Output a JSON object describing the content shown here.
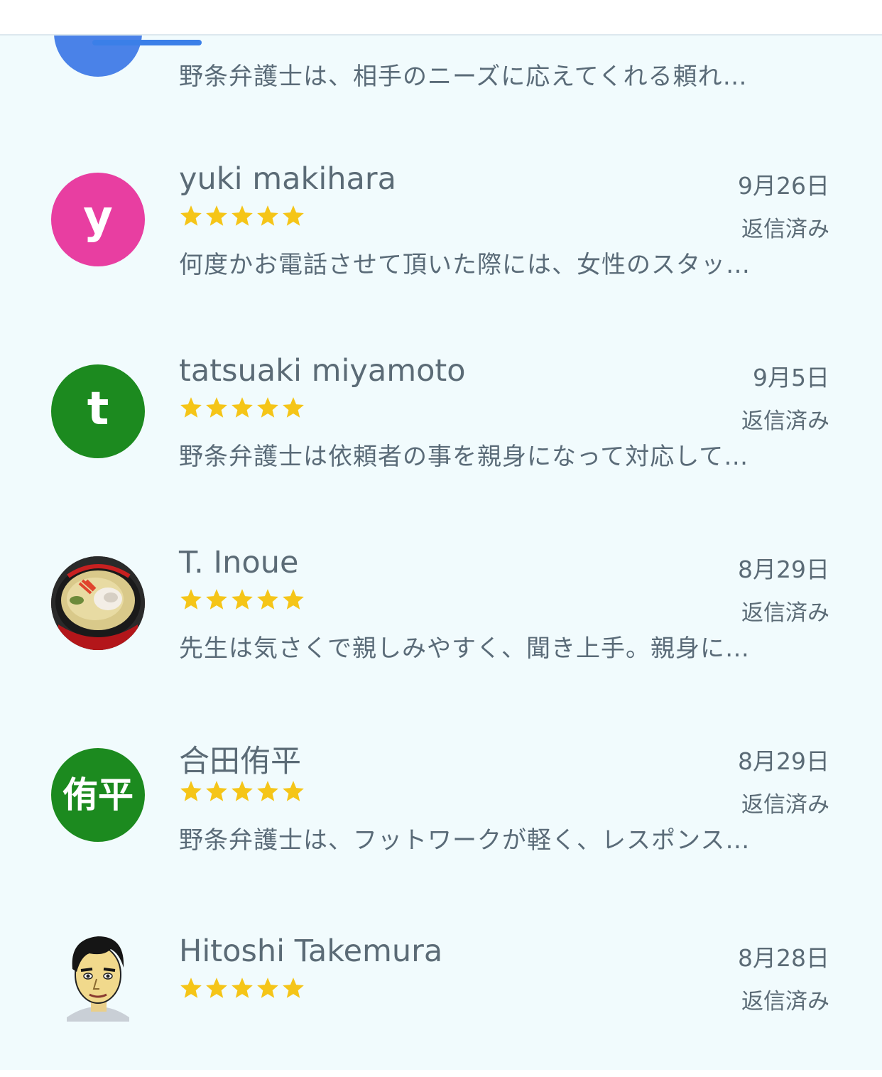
{
  "partial_review": {
    "snippet": "野条弁護士は、相手のニーズに応えてくれる頼れ…"
  },
  "reviews": [
    {
      "name": "yuki makihara",
      "date": "9月26日",
      "rating": 5,
      "status": "返信済み",
      "snippet": "何度かお電話させて頂いた際には、女性のスタッ…",
      "avatar": {
        "type": "letter",
        "text": "y",
        "color": "#e83ea1"
      }
    },
    {
      "name": "tatsuaki miyamoto",
      "date": "9月5日",
      "rating": 5,
      "status": "返信済み",
      "snippet": "野条弁護士は依頼者の事を親身になって対応して…",
      "avatar": {
        "type": "letter",
        "text": "t",
        "color": "#1c8a1f"
      }
    },
    {
      "name": "T. Inoue",
      "date": "8月29日",
      "rating": 5,
      "status": "返信済み",
      "snippet": "先生は気さくで親しみやすく、聞き上手。親身に…",
      "avatar": {
        "type": "photo",
        "icon": "ramen-photo"
      }
    },
    {
      "name": "合田侑平",
      "date": "8月29日",
      "rating": 5,
      "status": "返信済み",
      "snippet": "野条弁護士は、フットワークが軽く、レスポンス…",
      "avatar": {
        "type": "kanji",
        "text": "侑平",
        "color": "#1c8a1f"
      }
    },
    {
      "name": "Hitoshi Takemura",
      "date": "8月28日",
      "rating": 5,
      "status": "返信済み",
      "avatar": {
        "type": "photo",
        "icon": "caricature-portrait"
      }
    }
  ],
  "colors": {
    "star": "#f5c518",
    "text": "#5b6b76",
    "background": "#f1fbfd",
    "accent": "#3b7fe8"
  }
}
